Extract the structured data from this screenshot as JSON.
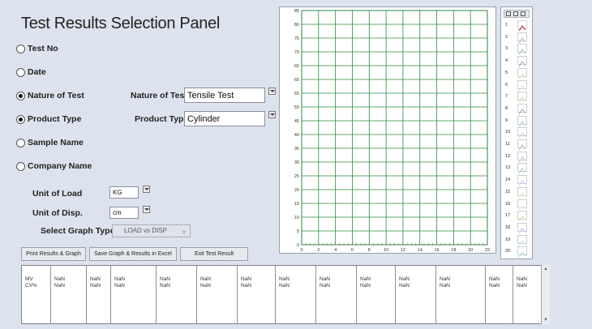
{
  "panel": {
    "title": "Test Results Selection Panel"
  },
  "radios": {
    "test_no": "Test No",
    "date": "Date",
    "nature_of_test": "Nature of Test",
    "product_type": "Product Type",
    "sample_name": "Sample Name",
    "company_name": "Company Name"
  },
  "fields": {
    "nature_of_test_label": "Nature of Test",
    "nature_of_test_value": "Tensile Test",
    "product_type_label": "Product Type",
    "product_type_value": "Cylinder",
    "unit_of_load_label": "Unit of Load",
    "unit_of_load_value": "KG",
    "unit_of_disp_label": "Unit of Disp.",
    "unit_of_disp_value": "cm",
    "graph_type_label": "Select Graph Type",
    "graph_type_value": "LOAD vs DISP"
  },
  "buttons": {
    "print": "Print Results & Graph",
    "save": "Save Graph & Results in Excel",
    "exit": "Exit Test Result"
  },
  "legend": {
    "numbers": [
      "1",
      "2",
      "3",
      "4",
      "5",
      "6",
      "7",
      "8",
      "9",
      "10",
      "11",
      "12",
      "13",
      "14",
      "15",
      "16",
      "17",
      "18",
      "19",
      "20"
    ],
    "colors": [
      "#d01010",
      "#c8a0c8",
      "#8fcaa0",
      "#8fa8d8",
      "#e6e6a0",
      "#c8e6c8",
      "#e6d0a0",
      "#a0a0c8",
      "#a0c8e6",
      "#c8c8e6",
      "#b0b0b0",
      "#d0b0e0",
      "#a0d8a0",
      "#b8d0f0",
      "#f0e0a0",
      "#d8f0d8",
      "#f0d0a0",
      "#b8b8e0",
      "#c0e0f0",
      "#a8d8f0"
    ]
  },
  "chart_data": {
    "type": "line",
    "title": "",
    "xlabel": "",
    "ylabel": "",
    "xlim": [
      0,
      22
    ],
    "ylim": [
      0,
      85
    ],
    "x_ticks": [
      "0",
      "2",
      "4",
      "6",
      "8",
      "10",
      "12",
      "14",
      "16",
      "18",
      "20",
      "22"
    ],
    "y_ticks": [
      "0",
      "5",
      "10",
      "15",
      "20",
      "25",
      "30",
      "35",
      "40",
      "45",
      "50",
      "55",
      "60",
      "65",
      "70",
      "75",
      "80",
      "85"
    ],
    "grid": true,
    "series": []
  },
  "table": {
    "columns": [
      {
        "a": "MV",
        "b": "CV%"
      },
      {
        "a": "NaN",
        "b": "NaN"
      },
      {
        "a": "NaN",
        "b": "NaN"
      },
      {
        "a": "NaN",
        "b": "NaN"
      },
      {
        "a": "NaN",
        "b": "NaN"
      },
      {
        "a": "NaN",
        "b": "NaN"
      },
      {
        "a": "NaN",
        "b": "NaN"
      },
      {
        "a": "NaN",
        "b": "NaN"
      },
      {
        "a": "NaN",
        "b": "NaN"
      },
      {
        "a": "NaN",
        "b": "NaN"
      },
      {
        "a": "NaN",
        "b": "NaN"
      },
      {
        "a": "NaN",
        "b": "NaN"
      },
      {
        "a": "NaN",
        "b": "NaN"
      },
      {
        "a": "NaN",
        "b": "NaN"
      }
    ]
  }
}
